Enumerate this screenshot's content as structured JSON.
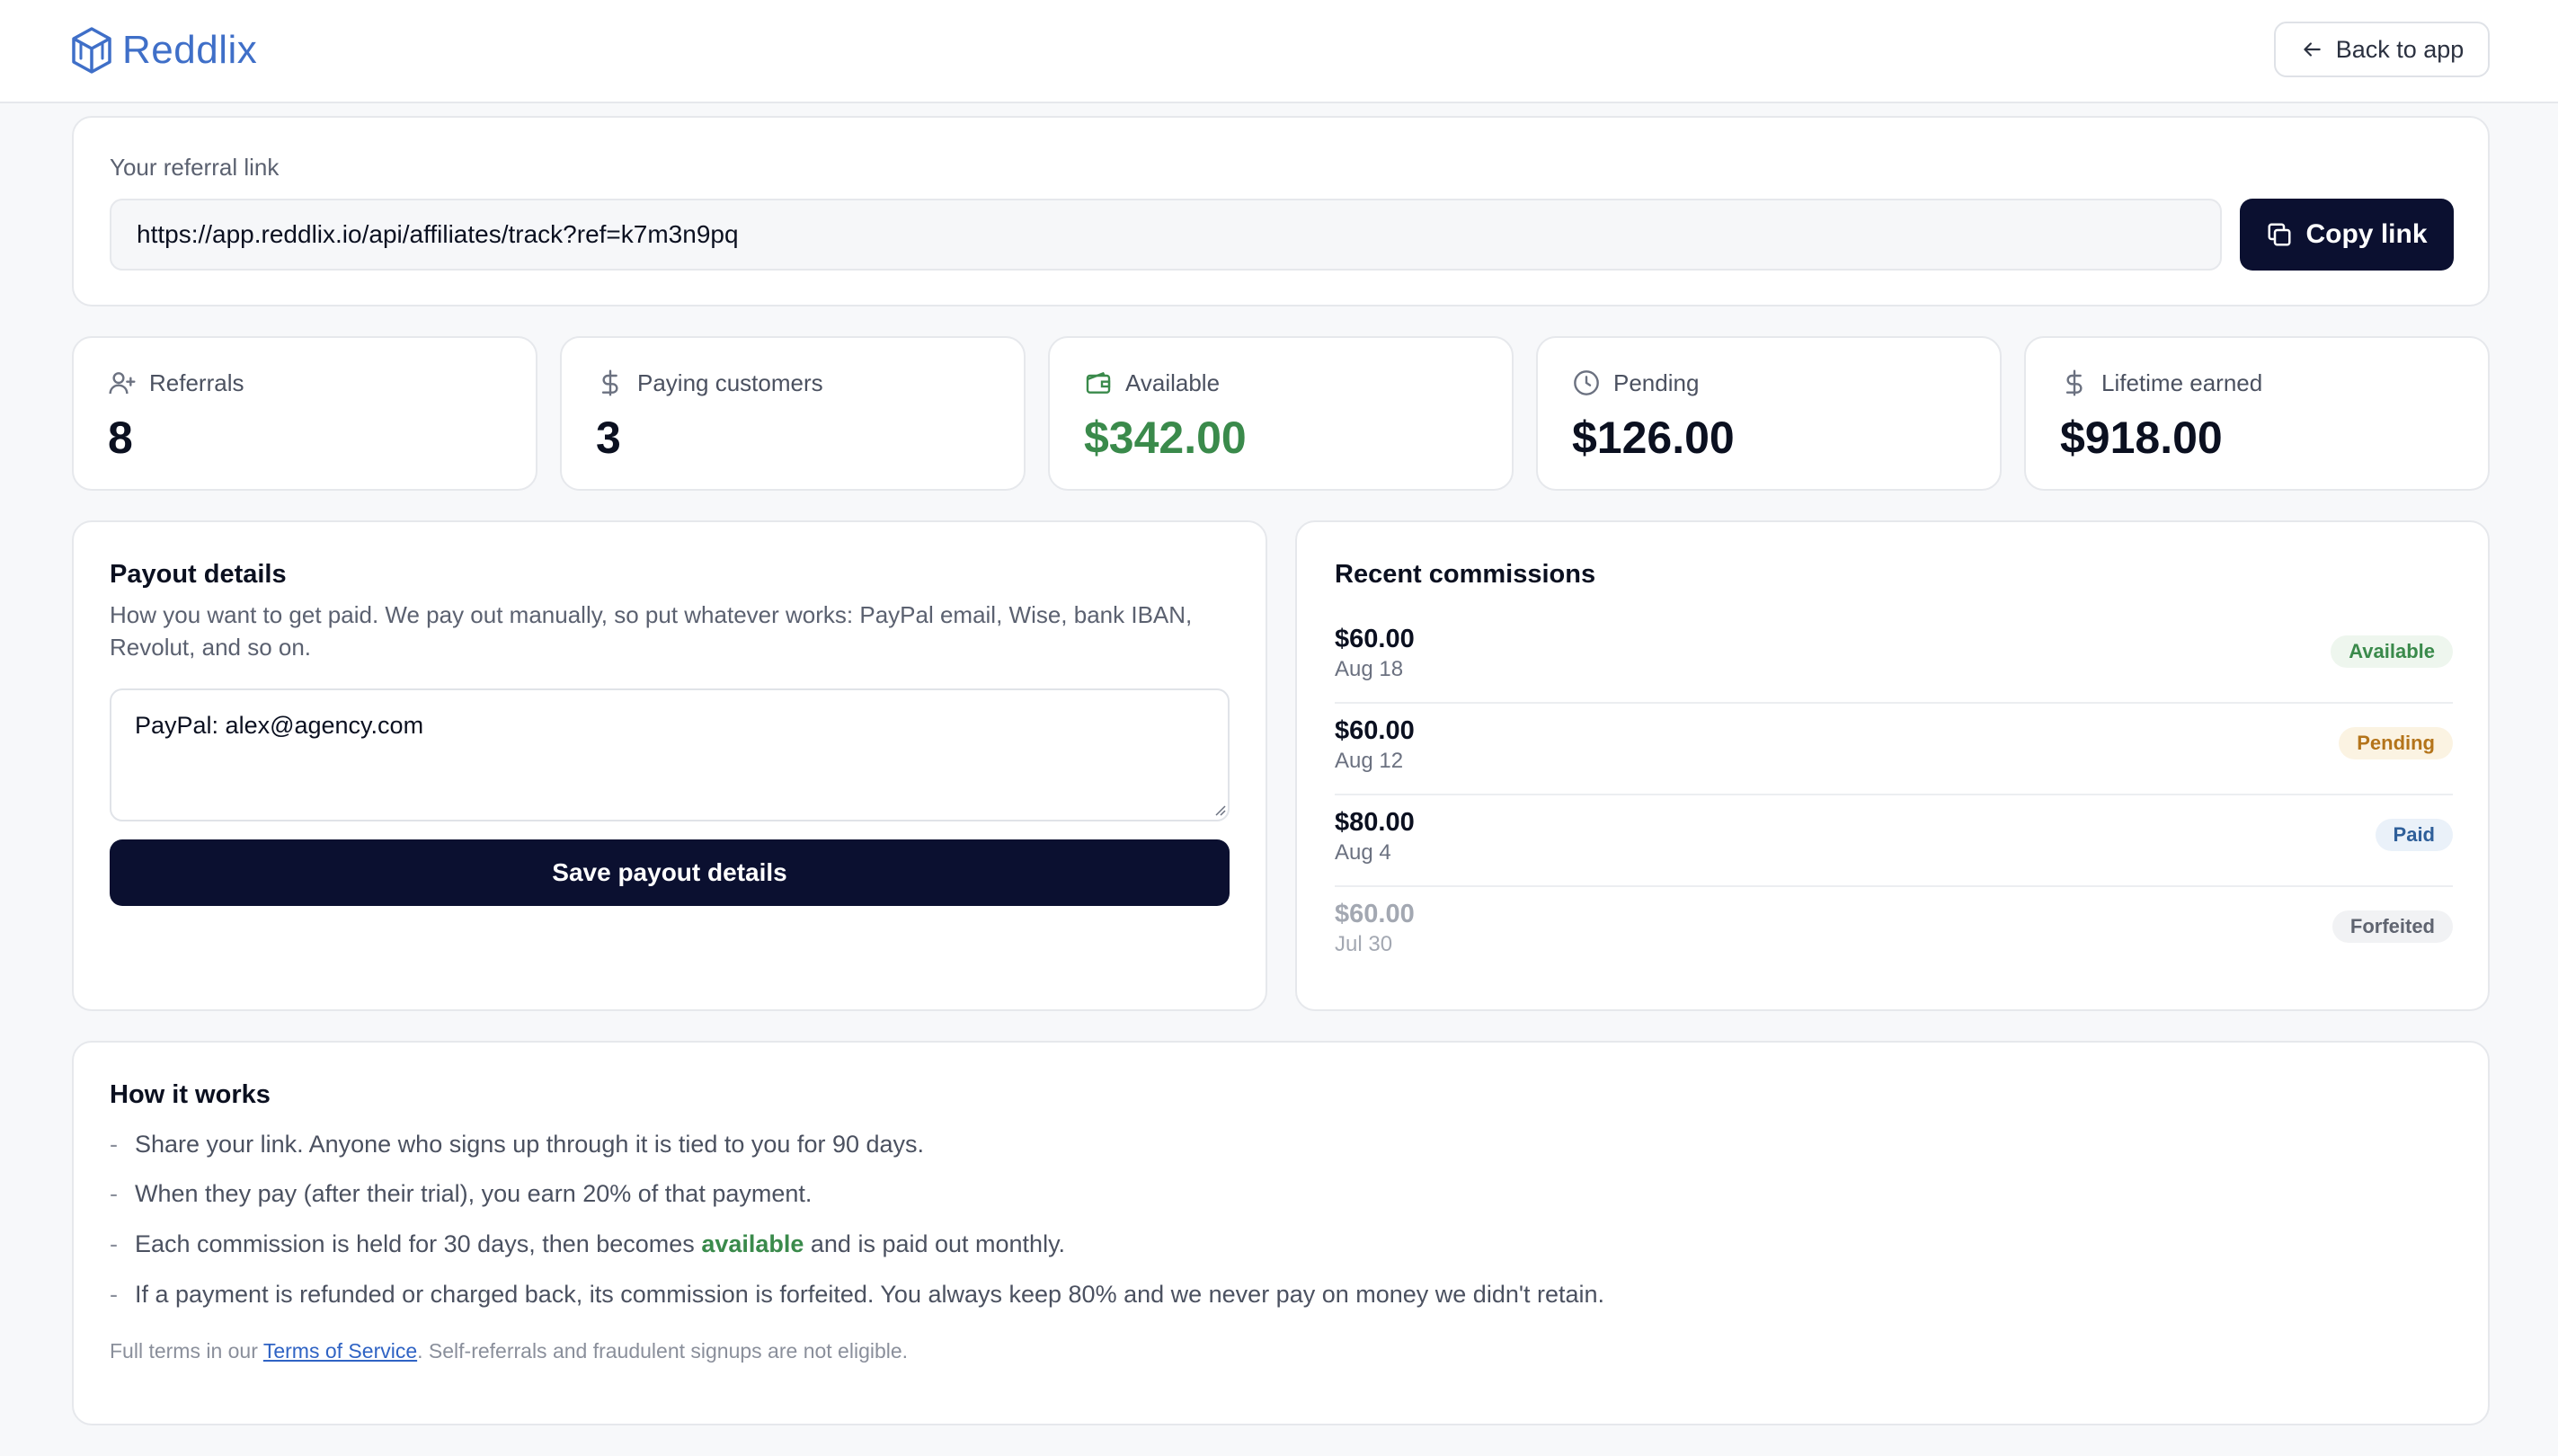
{
  "header": {
    "brand": "Reddlix",
    "back_label": "Back to app"
  },
  "referral": {
    "label": "Your referral link",
    "url": "https://app.reddlix.io/api/affiliates/track?ref=k7m3n9pq",
    "copy_label": "Copy link"
  },
  "stats": [
    {
      "label": "Referrals",
      "value": "8",
      "icon": "user-plus-icon"
    },
    {
      "label": "Paying customers",
      "value": "3",
      "icon": "dollar-icon"
    },
    {
      "label": "Available",
      "value": "$342.00",
      "icon": "wallet-icon",
      "color": "#3a8a4b"
    },
    {
      "label": "Pending",
      "value": "$126.00",
      "icon": "clock-icon"
    },
    {
      "label": "Lifetime earned",
      "value": "$918.00",
      "icon": "dollar-icon"
    }
  ],
  "payout": {
    "title": "Payout details",
    "description": "How you want to get paid. We pay out manually, so put whatever works: PayPal email, Wise, bank IBAN, Revolut, and so on.",
    "value": "PayPal: alex@agency.com",
    "save_label": "Save payout details"
  },
  "commissions": {
    "title": "Recent commissions",
    "items": [
      {
        "amount": "$60.00",
        "date": "Aug 18",
        "status": "Available"
      },
      {
        "amount": "$60.00",
        "date": "Aug 12",
        "status": "Pending"
      },
      {
        "amount": "$80.00",
        "date": "Aug 4",
        "status": "Paid"
      },
      {
        "amount": "$60.00",
        "date": "Jul 30",
        "status": "Forfeited"
      }
    ]
  },
  "how": {
    "title": "How it works",
    "item1": "Share your link. Anyone who signs up through it is tied to you for 90 days.",
    "item2": "When they pay (after their trial), you earn 20% of that payment.",
    "item3_before": "Each commission is held for 30 days, then becomes ",
    "item3_highlight": "available",
    "item3_after": " and is paid out monthly.",
    "item4": "If a payment is refunded or charged back, its commission is forfeited. You always keep 80% and we never pay on money we didn't retain.",
    "foot_before": "Full terms in our ",
    "foot_link": "Terms of Service",
    "foot_after": ". Self-referrals and fraudulent signups are not eligible.",
    "dash": "-"
  },
  "colors": {
    "accent_dark": "#0b1030",
    "brand_blue": "#3f6fc8",
    "green": "#3a8a4b"
  }
}
